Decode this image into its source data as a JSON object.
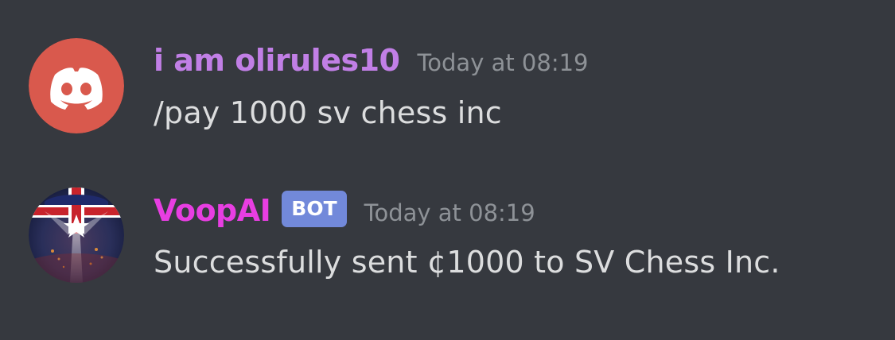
{
  "messages": [
    {
      "author": "i am olirules10",
      "author_color": "#c17fe6",
      "timestamp": "Today at 08:19",
      "text": "/pay 1000 sv chess inc",
      "avatar_icon": "discord-default-avatar-icon",
      "avatar_color": "#d9594d",
      "is_bot": false
    },
    {
      "author": "VoopAI",
      "author_color": "#e83ee2",
      "badge": "BOT",
      "timestamp": "Today at 08:19",
      "text": "Successfully sent ¢1000 to SV Chess Inc.",
      "avatar_icon": "flag-globe-avatar-icon",
      "is_bot": true
    }
  ],
  "colors": {
    "background": "#36393f",
    "text": "#dcddde",
    "timestamp": "#8e9297",
    "bot_badge": "#7289da"
  }
}
